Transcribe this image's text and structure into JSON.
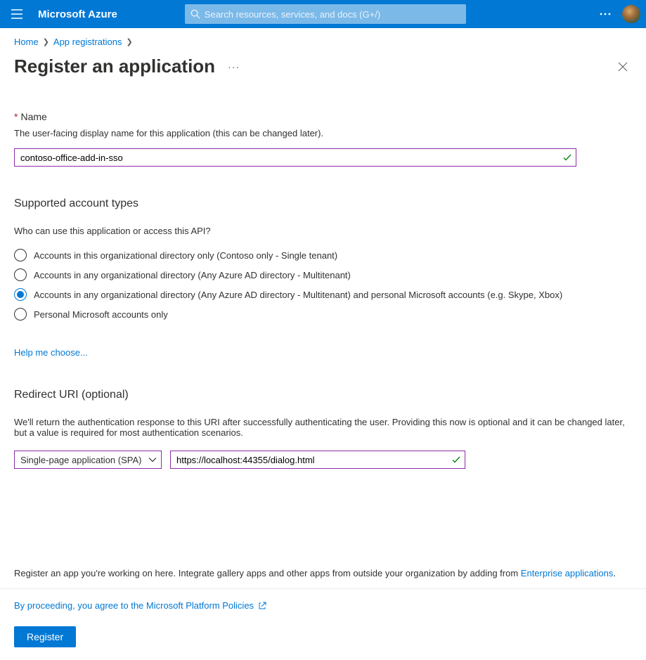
{
  "topbar": {
    "brand": "Microsoft Azure",
    "search_placeholder": "Search resources, services, and docs (G+/)"
  },
  "breadcrumb": {
    "home": "Home",
    "app_reg": "App registrations"
  },
  "title": "Register an application",
  "name_section": {
    "label": "Name",
    "desc": "The user-facing display name for this application (this can be changed later).",
    "value": "contoso-office-add-in-sso"
  },
  "account_types": {
    "heading": "Supported account types",
    "question": "Who can use this application or access this API?",
    "options": [
      "Accounts in this organizational directory only (Contoso only - Single tenant)",
      "Accounts in any organizational directory (Any Azure AD directory - Multitenant)",
      "Accounts in any organizational directory (Any Azure AD directory - Multitenant) and personal Microsoft accounts (e.g. Skype, Xbox)",
      "Personal Microsoft accounts only"
    ],
    "help_link": "Help me choose..."
  },
  "redirect": {
    "heading": "Redirect URI (optional)",
    "desc": "We'll return the authentication response to this URI after successfully authenticating the user. Providing this now is optional and it can be changed later, but a value is required for most authentication scenarios.",
    "platform": "Single-page application (SPA)",
    "uri": "https://localhost:44355/dialog.html"
  },
  "bottom_note": {
    "text_before": "Register an app you're working on here. Integrate gallery apps and other apps from outside your organization by adding from ",
    "link": "Enterprise applications",
    "text_after": "."
  },
  "footer": {
    "policy": "By proceeding, you agree to the Microsoft Platform Policies",
    "register": "Register"
  }
}
